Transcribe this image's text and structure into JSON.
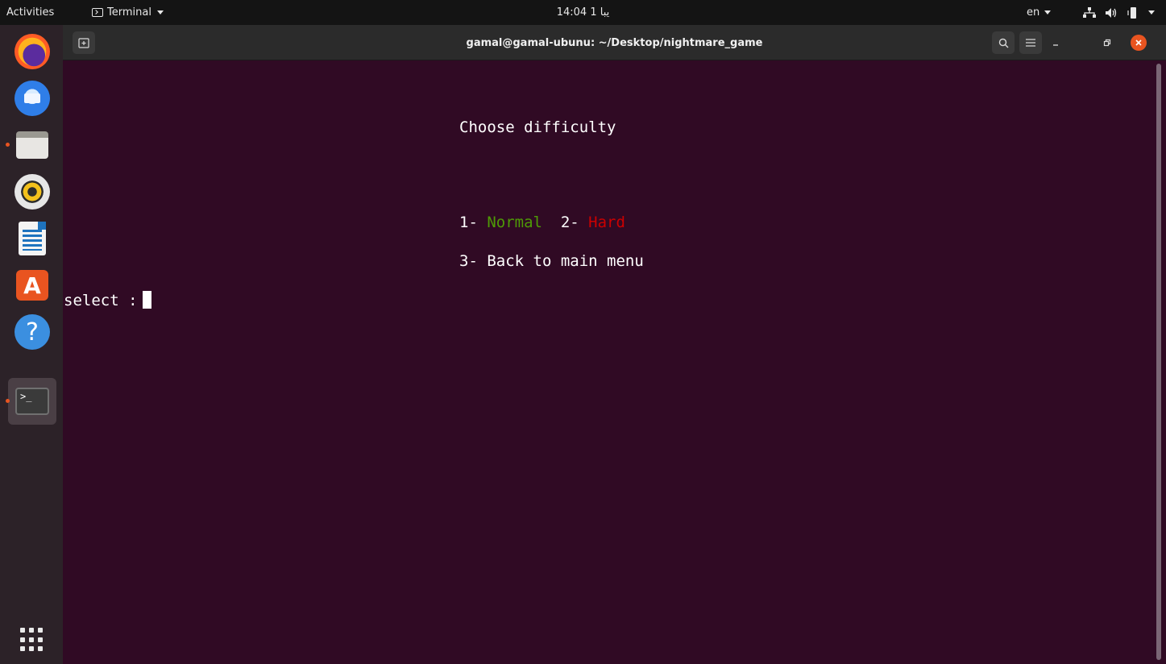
{
  "topbar": {
    "activities": "Activities",
    "app_menu": "Terminal",
    "clock": "14:04 1 يبا",
    "lang": "en"
  },
  "dock": {
    "apps": [
      {
        "name": "Firefox",
        "icon": "firefox-icon",
        "running": false
      },
      {
        "name": "Thunderbird",
        "icon": "thunderbird-icon",
        "running": false
      },
      {
        "name": "Files",
        "icon": "files-icon",
        "running": true
      },
      {
        "name": "Rhythmbox",
        "icon": "rhythmbox-icon",
        "running": false
      },
      {
        "name": "LibreOffice Writer",
        "icon": "writer-icon",
        "running": false
      },
      {
        "name": "Ubuntu Software",
        "icon": "software-icon",
        "running": false
      },
      {
        "name": "Help",
        "icon": "help-icon",
        "running": false
      },
      {
        "name": "Terminal",
        "icon": "terminal-icon",
        "running": true,
        "active": true
      }
    ],
    "software_glyph": "A",
    "help_glyph": "?",
    "terminal_glyph": ">_"
  },
  "window": {
    "title": "gamal@gamal-ubunu: ~/Desktop/nightmare_game"
  },
  "terminal": {
    "heading": "Choose difficulty",
    "opt1_prefix": "1- ",
    "opt1_label": "Normal",
    "opt2_prefix": "  2- ",
    "opt2_label": "Hard",
    "back_option": "3- Back to main menu",
    "prompt": "select :",
    "colors": {
      "normal": "#4e9a06",
      "hard": "#cc0000",
      "background": "#300a24"
    }
  }
}
